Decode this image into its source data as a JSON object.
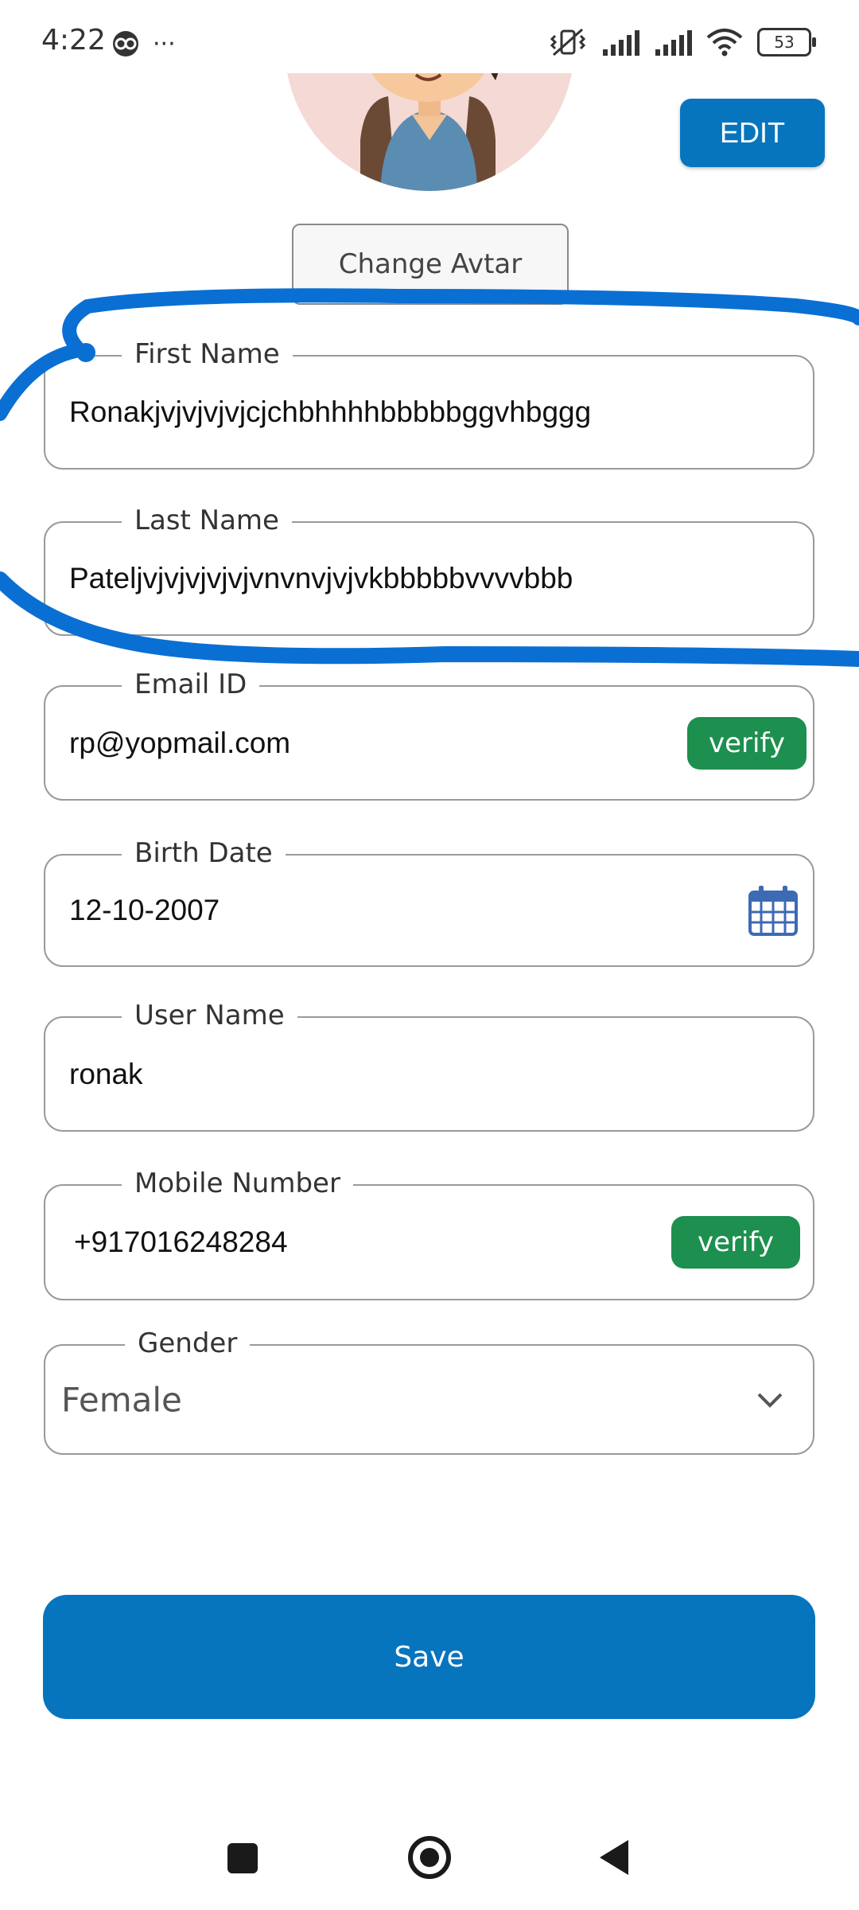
{
  "status_bar": {
    "time": "4:22",
    "more_glyph": "···",
    "battery": "53"
  },
  "header": {
    "edit_label": "EDIT",
    "change_avatar_label": "Change Avtar"
  },
  "form": {
    "first_name": {
      "label": "First Name",
      "value": "Ronakjvjvjvjvjcjchbhhhhbbbbbggvhbggg"
    },
    "last_name": {
      "label": "Last Name",
      "value": "Pateljvjvjvjvjvjvnvnvjvjvkbbbbbvvvvbbb"
    },
    "email": {
      "label": "Email ID",
      "value": "rp@yopmail.com",
      "verify_label": "verify"
    },
    "birth_date": {
      "label": "Birth Date",
      "value": "12-10-2007"
    },
    "user_name": {
      "label": "User Name",
      "value": "ronak"
    },
    "mobile": {
      "label": "Mobile Number",
      "value": "+917016248284",
      "verify_label": "verify"
    },
    "gender": {
      "label": "Gender",
      "selected": "Female"
    }
  },
  "save_label": "Save",
  "colors": {
    "primary": "#0775bd",
    "verify": "#1d8f4e",
    "annotation": "#0a6fd3"
  }
}
